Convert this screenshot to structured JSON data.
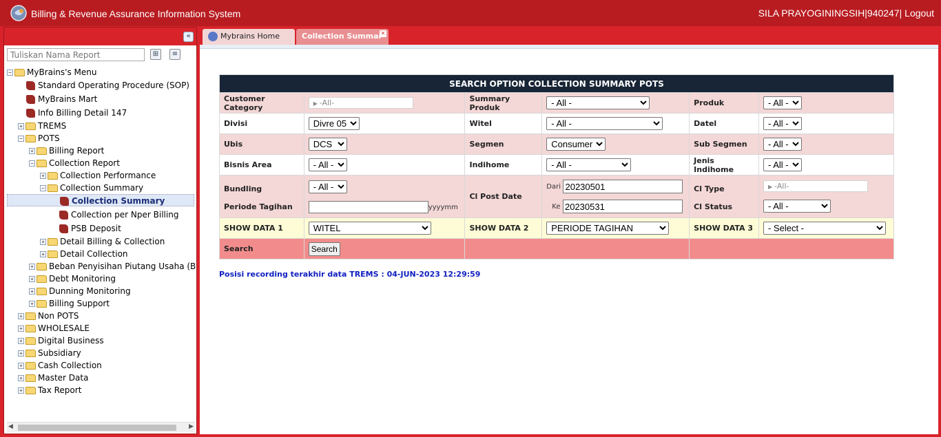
{
  "header": {
    "title": "Billing & Revenue Assurance Information System",
    "user": "SILA PRAYOGININGSIH|940247|",
    "logout": "Logout"
  },
  "sidebar": {
    "search_placeholder": "Tuliskan Nama Report",
    "tree": [
      {
        "label": "MyBrains's Menu",
        "type": "folder",
        "toggle": "−"
      },
      {
        "label": "Standard Operating Procedure (SOP)",
        "type": "report"
      },
      {
        "label": "MyBrains Mart",
        "type": "report"
      },
      {
        "label": "Info Billing Detail 147",
        "type": "report"
      },
      {
        "label": "TREMS",
        "type": "folder",
        "toggle": "+"
      },
      {
        "label": "POTS",
        "type": "folder",
        "toggle": "−"
      },
      {
        "label": "Billing Report",
        "type": "folder",
        "toggle": "+"
      },
      {
        "label": "Collection Report",
        "type": "folder",
        "toggle": "−"
      },
      {
        "label": "Collection Performance",
        "type": "folder",
        "toggle": "+"
      },
      {
        "label": "Collection Summary",
        "type": "folder",
        "toggle": "−"
      },
      {
        "label": "Collection Summary",
        "type": "report",
        "selected": true
      },
      {
        "label": "Collection per Nper Billing",
        "type": "report"
      },
      {
        "label": "PSB Deposit",
        "type": "report"
      },
      {
        "label": "Detail Billing & Collection",
        "type": "folder",
        "toggle": "+"
      },
      {
        "label": "Detail Collection",
        "type": "folder",
        "toggle": "+"
      },
      {
        "label": "Beban Penyisihan Piutang Usaha (BPP",
        "type": "folder",
        "toggle": "+"
      },
      {
        "label": "Debt Monitoring",
        "type": "folder",
        "toggle": "+"
      },
      {
        "label": "Dunning Monitoring",
        "type": "folder",
        "toggle": "+"
      },
      {
        "label": "Billing Support",
        "type": "folder",
        "toggle": "+"
      },
      {
        "label": "Non POTS",
        "type": "folder",
        "toggle": "+"
      },
      {
        "label": "WHOLESALE",
        "type": "folder",
        "toggle": "+"
      },
      {
        "label": "Digital Business",
        "type": "folder",
        "toggle": "+"
      },
      {
        "label": "Subsidiary",
        "type": "folder",
        "toggle": "+"
      },
      {
        "label": "Cash Collection",
        "type": "folder",
        "toggle": "+"
      },
      {
        "label": "Master Data",
        "type": "folder",
        "toggle": "+"
      },
      {
        "label": "Tax Report",
        "type": "folder",
        "toggle": "+"
      }
    ]
  },
  "tabs": {
    "home": "Mybrains Home",
    "collection": "Collection Summar"
  },
  "form": {
    "title": "SEARCH OPTION COLLECTION SUMMARY POTS",
    "customer_category": {
      "label": "Customer Category",
      "value": "-All-"
    },
    "summary_produk": {
      "label": "Summary Produk",
      "value": "- All -"
    },
    "produk": {
      "label": "Produk",
      "value": "- All -"
    },
    "divisi": {
      "label": "Divisi",
      "value": "Divre 05"
    },
    "witel": {
      "label": "Witel",
      "value": "- All -"
    },
    "datel": {
      "label": "Datel",
      "value": "- All -"
    },
    "ubis": {
      "label": "Ubis",
      "value": "DCS"
    },
    "segmen": {
      "label": "Segmen",
      "value": "Consumer"
    },
    "sub_segmen": {
      "label": "Sub Segmen",
      "value": "- All -"
    },
    "bisnis_area": {
      "label": "Bisnis Area",
      "value": "- All -"
    },
    "indihome": {
      "label": "Indihome",
      "value": "- All -"
    },
    "jenis_indihome": {
      "label": "Jenis Indihome",
      "value": "- All -"
    },
    "bundling": {
      "label": "Bundling",
      "value": "- All -"
    },
    "periode_tagihan": {
      "label": "Periode Tagihan",
      "value": "",
      "hint": "yyyymm"
    },
    "cl_post_date": {
      "label": "Cl Post Date",
      "dari_label": "Dari",
      "dari": "20230501",
      "ke_label": "Ke",
      "ke": "20230531"
    },
    "cl_type": {
      "label": "Cl Type",
      "value": "-All-"
    },
    "cl_status": {
      "label": "Cl Status",
      "value": "- All -"
    },
    "show_data_1": {
      "label": "SHOW DATA 1",
      "value": "WITEL"
    },
    "show_data_2": {
      "label": "SHOW DATA 2",
      "value": "PERIODE TAGIHAN"
    },
    "show_data_3": {
      "label": "SHOW DATA 3",
      "value": "- Select -"
    },
    "search_label": "Search",
    "search_button": "Search"
  },
  "footer_note": "Posisi recording terakhir data TREMS : 04-JUN-2023 12:29:59",
  "colors": {
    "header": "#b81c21",
    "frame": "#d9232a",
    "title_bar": "#172536",
    "note_text": "#1020c0"
  }
}
